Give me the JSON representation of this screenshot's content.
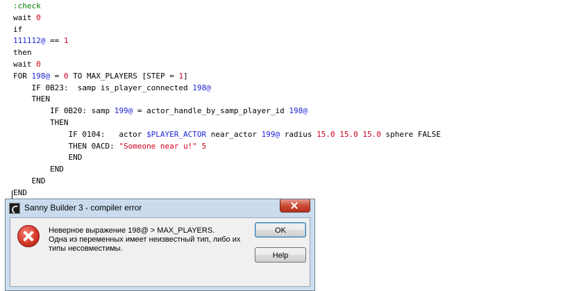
{
  "editor": {
    "lines": [
      [
        {
          "t": ":check",
          "c": "lbl"
        }
      ],
      [
        {
          "t": "wait ",
          "c": "kw"
        },
        {
          "t": "0",
          "c": "num"
        }
      ],
      [
        {
          "t": "if",
          "c": "kw"
        }
      ],
      [
        {
          "t": "111112@",
          "c": "var"
        },
        {
          "t": " == ",
          "c": "kw"
        },
        {
          "t": "1",
          "c": "num"
        }
      ],
      [
        {
          "t": "then",
          "c": "kw"
        }
      ],
      [
        {
          "t": "wait ",
          "c": "kw"
        },
        {
          "t": "0",
          "c": "num"
        }
      ],
      [
        {
          "t": "FOR ",
          "c": "kw"
        },
        {
          "t": "198@",
          "c": "var"
        },
        {
          "t": " = ",
          "c": "kw"
        },
        {
          "t": "0",
          "c": "num"
        },
        {
          "t": " TO MAX_PLAYERS [STEP = ",
          "c": "kw"
        },
        {
          "t": "1",
          "c": "num"
        },
        {
          "t": "]",
          "c": "kw"
        }
      ],
      [
        {
          "t": "    IF 0B23:  samp is_player_connected ",
          "c": "kw"
        },
        {
          "t": "198@",
          "c": "var"
        }
      ],
      [
        {
          "t": "    THEN",
          "c": "kw"
        }
      ],
      [
        {
          "t": "        IF 0B20: samp ",
          "c": "kw"
        },
        {
          "t": "199@",
          "c": "var"
        },
        {
          "t": " = actor_handle_by_samp_player_id ",
          "c": "kw"
        },
        {
          "t": "198@",
          "c": "var"
        }
      ],
      [
        {
          "t": "        THEN",
          "c": "kw"
        }
      ],
      [
        {
          "t": "            IF 0104:   actor ",
          "c": "kw"
        },
        {
          "t": "$PLAYER_ACTOR",
          "c": "var"
        },
        {
          "t": " near_actor ",
          "c": "kw"
        },
        {
          "t": "199@",
          "c": "var"
        },
        {
          "t": " radius ",
          "c": "kw"
        },
        {
          "t": "15.0 15.0 15.0",
          "c": "num"
        },
        {
          "t": " sphere FALSE",
          "c": "kw"
        }
      ],
      [
        {
          "t": "            THEN 0ACD: ",
          "c": "kw"
        },
        {
          "t": "\"Someone near u!\"",
          "c": "str"
        },
        {
          "t": " ",
          "c": "kw"
        },
        {
          "t": "5",
          "c": "num"
        }
      ],
      [
        {
          "t": "            END",
          "c": "kw"
        }
      ],
      [
        {
          "t": "        END",
          "c": "kw"
        }
      ],
      [
        {
          "t": "    END",
          "c": "kw"
        }
      ],
      [
        {
          "t": "END",
          "c": "kw"
        }
      ]
    ]
  },
  "dialog": {
    "title": "Sanny Builder 3 - compiler error",
    "message_line1": "Неверное выражение 198@ > MAX_PLAYERS.",
    "message_line2": "Одна из переменных имеет неизвестный тип, либо их",
    "message_line3": "типы несовместимы.",
    "ok_label": "OK",
    "help_label": "Help",
    "icon": "error-icon"
  }
}
